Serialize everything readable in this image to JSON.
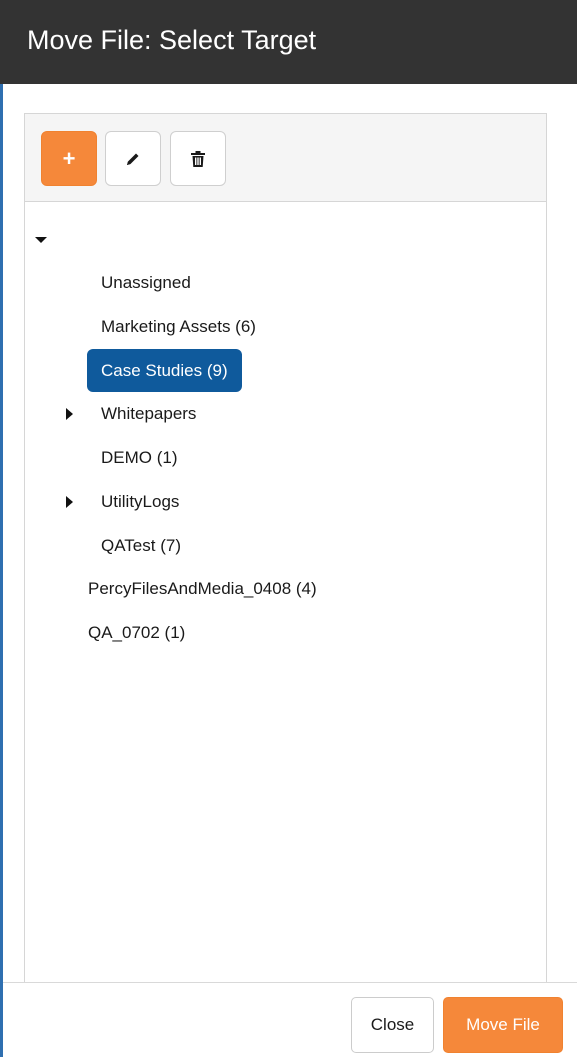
{
  "dialog": {
    "title": "Move File: Select Target"
  },
  "toolbar": {
    "add_icon": "plus-icon",
    "edit_icon": "pencil-icon",
    "delete_icon": "trash-icon",
    "add_symbol": "+"
  },
  "tree": {
    "root_expanded": true,
    "items": [
      {
        "label": "Unassigned",
        "has_children": false,
        "selected": false
      },
      {
        "label": "Marketing Assets (6)",
        "has_children": false,
        "selected": false
      },
      {
        "label": "Case Studies (9)",
        "has_children": false,
        "selected": true
      },
      {
        "label": "Whitepapers",
        "has_children": true,
        "selected": false
      },
      {
        "label": "DEMO (1)",
        "has_children": false,
        "selected": false
      },
      {
        "label": "UtilityLogs",
        "has_children": true,
        "selected": false
      },
      {
        "label": "QATest (7)",
        "has_children": false,
        "selected": false
      },
      {
        "label": "PercyFilesAndMedia_0408 (4)",
        "has_children": false,
        "selected": false
      },
      {
        "label": "QA_0702 (1)",
        "has_children": false,
        "selected": false
      }
    ]
  },
  "footer": {
    "close_label": "Close",
    "move_label": "Move File"
  },
  "colors": {
    "header_bg": "#333333",
    "accent_orange": "#f5883a",
    "selected_blue": "#0f5a9c"
  }
}
